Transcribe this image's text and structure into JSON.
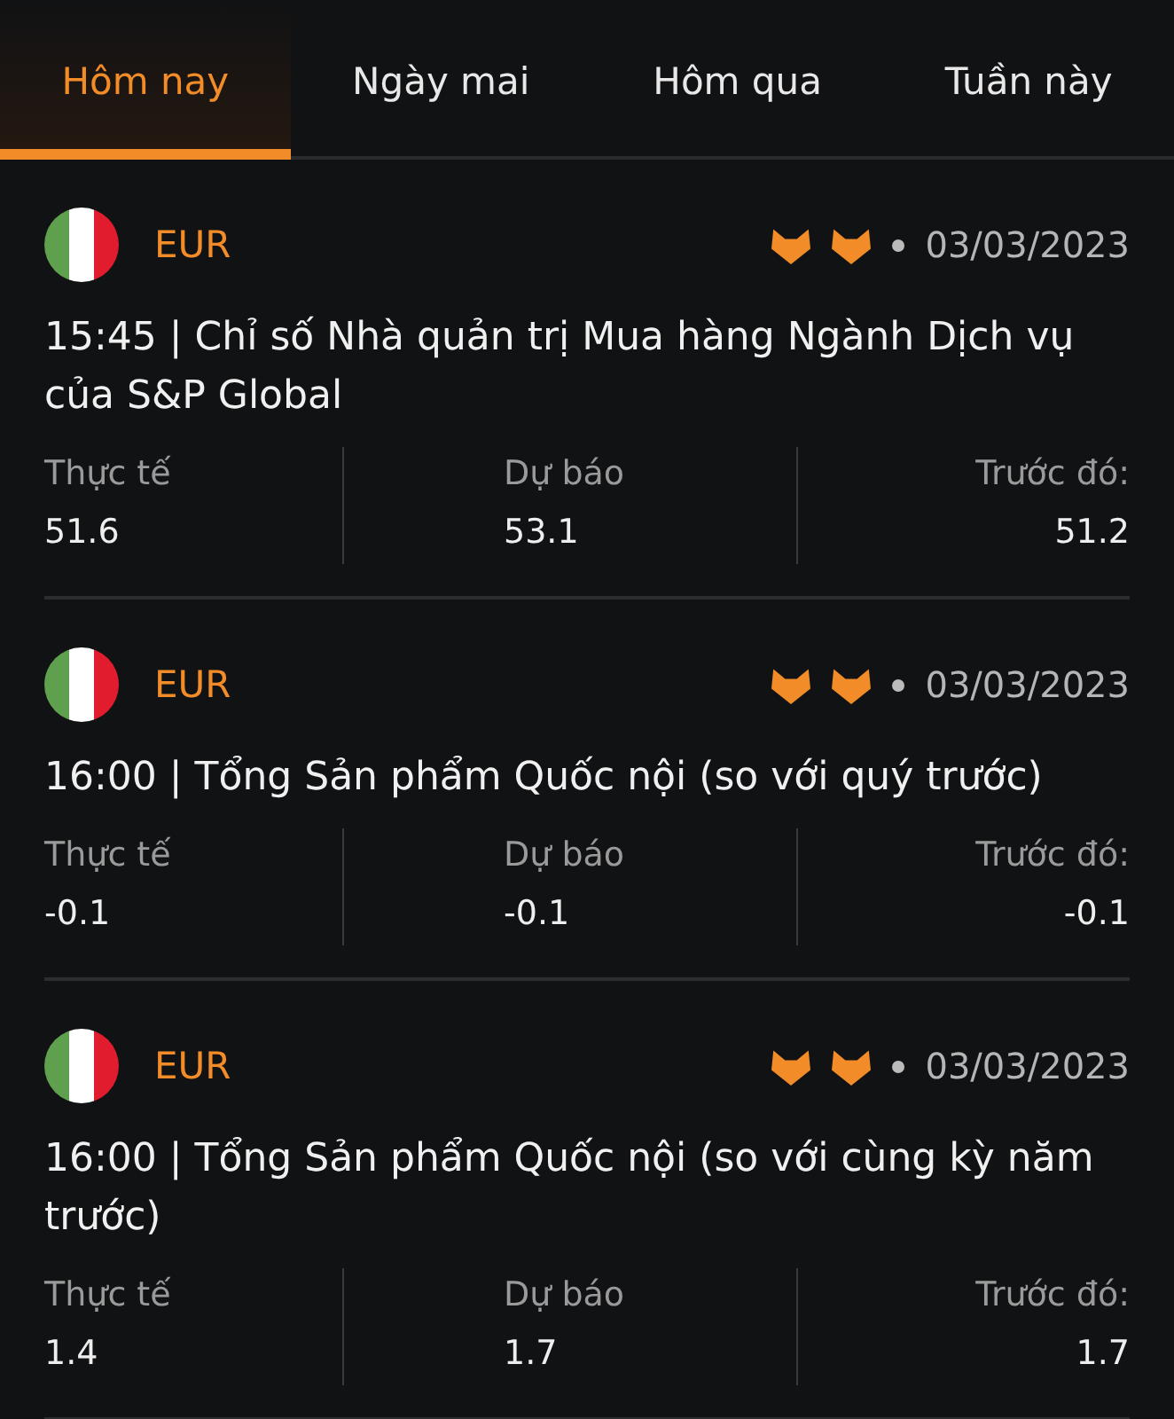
{
  "tabs": [
    {
      "label": "Hôm nay",
      "selected": true
    },
    {
      "label": "Ngày mai",
      "selected": false
    },
    {
      "label": "Hôm qua",
      "selected": false
    },
    {
      "label": "Tuần này",
      "selected": false
    }
  ],
  "events": [
    {
      "currency": "EUR",
      "icons": [
        {
          "kind": "fox"
        },
        {
          "kind": "fox"
        }
      ],
      "date": "03/03/2023",
      "title": "15:45 | Chỉ số Nhà quản trị Mua hàng Ngành Dịch vụ của S&P Global",
      "stats": [
        {
          "label": "Thực tế",
          "value": "51.6"
        },
        {
          "label": "Dự báo",
          "value": "53.1"
        },
        {
          "label": "Trước đó:",
          "value": "51.2"
        }
      ]
    },
    {
      "currency": "EUR",
      "icons": [
        {
          "kind": "fox"
        },
        {
          "kind": "fox"
        }
      ],
      "date": "03/03/2023",
      "title": "16:00 | Tổng Sản phẩm Quốc nội (so với quý trước)",
      "stats": [
        {
          "label": "Thực tế",
          "value": "-0.1"
        },
        {
          "label": "Dự báo",
          "value": "-0.1"
        },
        {
          "label": "Trước đó:",
          "value": "-0.1"
        }
      ]
    },
    {
      "currency": "EUR",
      "icons": [
        {
          "kind": "fox"
        },
        {
          "kind": "fox"
        }
      ],
      "date": "03/03/2023",
      "title": "16:00 | Tổng Sản phẩm Quốc nội (so với cùng kỳ năm trước)",
      "stats": [
        {
          "label": "Thực tế",
          "value": "1.4"
        },
        {
          "label": "Dự báo",
          "value": "1.7"
        },
        {
          "label": "Trước đó:",
          "value": "1.7"
        }
      ]
    }
  ]
}
